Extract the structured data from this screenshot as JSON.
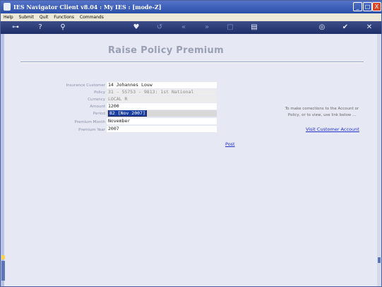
{
  "window": {
    "title": "IES Navigator Client v8.04 : My IES :    [mode-Z]",
    "controls": {
      "minimize": "_",
      "maximize": "□",
      "close": "X"
    }
  },
  "menu": [
    "Help",
    "Submit",
    "Quit",
    "Functions",
    "Commands"
  ],
  "toolbar": {
    "icons": [
      "key-icon",
      "help-icon",
      "search-icon",
      "heart-icon",
      "history-icon",
      "back-icon",
      "forward-icon",
      "document-icon",
      "page-icon",
      "globe-icon",
      "check-icon",
      "close-icon"
    ]
  },
  "form": {
    "heading": "Raise Policy Premium",
    "fields": [
      {
        "label": "Insurance Customer",
        "value": "14 Johannes Louw"
      },
      {
        "label": "Policy",
        "value": "31 - 55753 - 9813: 1st National"
      },
      {
        "label": "Currency",
        "value": "LOCAL R"
      },
      {
        "label": "Amount",
        "value": "1200"
      },
      {
        "label": "Period",
        "value": "82  [Nov 2007]"
      },
      {
        "label": "Premium Month",
        "value": "November"
      },
      {
        "label": "Premium Year",
        "value": "2007"
      }
    ],
    "post_label": "Post"
  },
  "side": {
    "note_line1": "To make corrections to the Account or",
    "note_line2": "Policy, or to view, use link below ...",
    "link_label": "Visit Customer Account"
  }
}
